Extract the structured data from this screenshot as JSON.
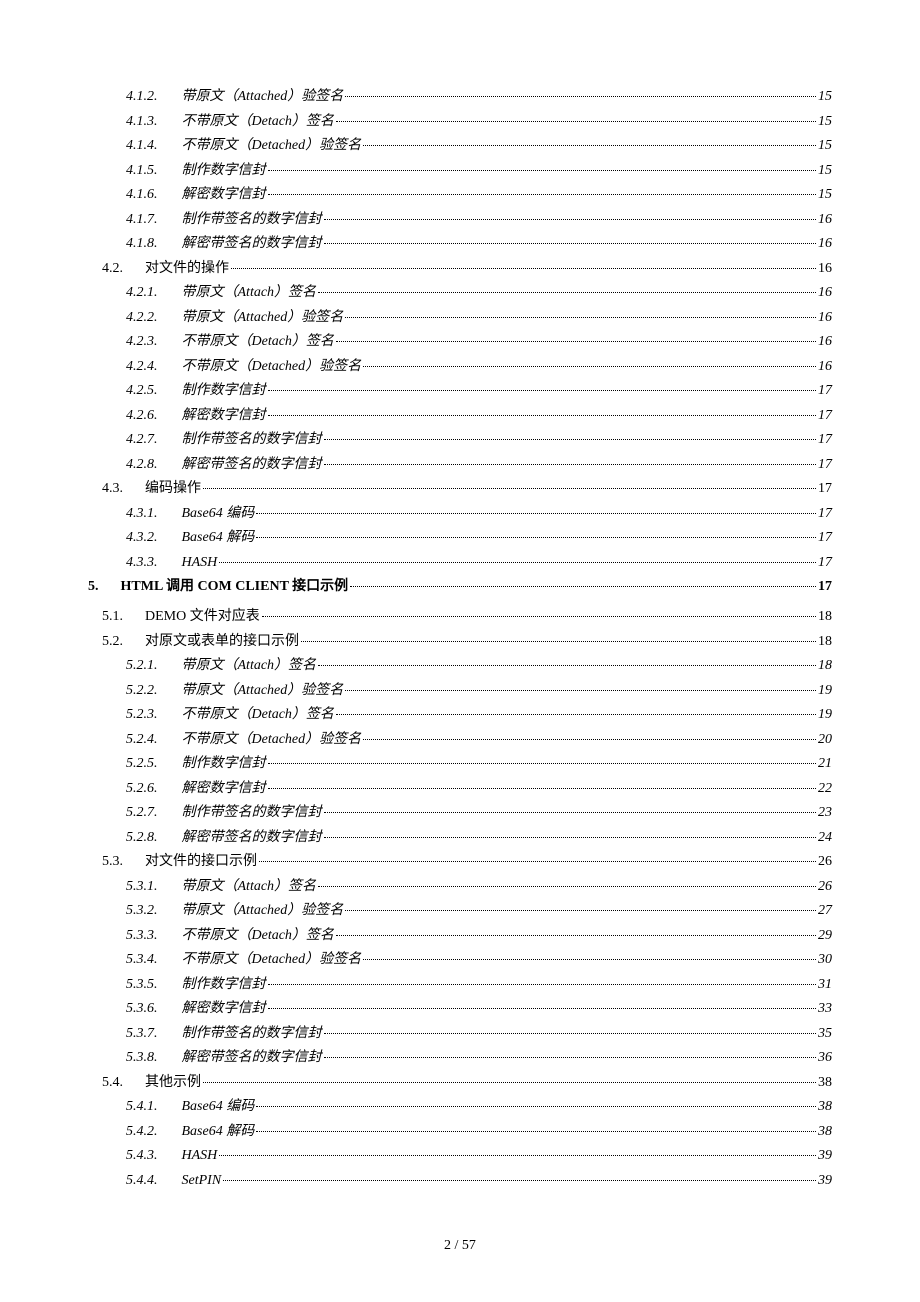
{
  "page_footer": "2 / 57",
  "toc": [
    {
      "level": 3,
      "num": "4.1.2.",
      "title": "带原文（Attached）验签名",
      "page": "15"
    },
    {
      "level": 3,
      "num": "4.1.3.",
      "title": "不带原文（Detach）签名",
      "page": "15"
    },
    {
      "level": 3,
      "num": "4.1.4.",
      "title": "不带原文（Detached）验签名",
      "page": "15"
    },
    {
      "level": 3,
      "num": "4.1.5.",
      "title": "制作数字信封",
      "page": "15"
    },
    {
      "level": 3,
      "num": "4.1.6.",
      "title": "解密数字信封",
      "page": "15"
    },
    {
      "level": 3,
      "num": "4.1.7.",
      "title": "制作带签名的数字信封",
      "page": "16"
    },
    {
      "level": 3,
      "num": "4.1.8.",
      "title": "解密带签名的数字信封",
      "page": "16"
    },
    {
      "level": 2,
      "num": "4.2.",
      "title": "对文件的操作",
      "page": "16"
    },
    {
      "level": 3,
      "num": "4.2.1.",
      "title": "带原文（Attach）签名",
      "page": "16"
    },
    {
      "level": 3,
      "num": "4.2.2.",
      "title": "带原文（Attached）验签名",
      "page": "16"
    },
    {
      "level": 3,
      "num": "4.2.3.",
      "title": "不带原文（Detach）签名",
      "page": "16"
    },
    {
      "level": 3,
      "num": "4.2.4.",
      "title": "不带原文（Detached）验签名",
      "page": "16"
    },
    {
      "level": 3,
      "num": "4.2.5.",
      "title": "制作数字信封",
      "page": "17"
    },
    {
      "level": 3,
      "num": "4.2.6.",
      "title": "解密数字信封",
      "page": "17"
    },
    {
      "level": 3,
      "num": "4.2.7.",
      "title": "制作带签名的数字信封",
      "page": "17"
    },
    {
      "level": 3,
      "num": "4.2.8.",
      "title": "解密带签名的数字信封",
      "page": "17"
    },
    {
      "level": 2,
      "num": "4.3.",
      "title": "编码操作",
      "page": "17"
    },
    {
      "level": 3,
      "num": "4.3.1.",
      "title": "Base64 编码",
      "page": "17"
    },
    {
      "level": 3,
      "num": "4.3.2.",
      "title": "Base64 解码",
      "page": "17"
    },
    {
      "level": 3,
      "num": "4.3.3.",
      "title": "HASH",
      "page": "17"
    },
    {
      "level": 1,
      "num": "5.",
      "title": "HTML 调用 COM CLIENT 接口示例",
      "page": "17"
    },
    {
      "level": 2,
      "num": "5.1.",
      "title": "DEMO 文件对应表",
      "page": "18",
      "smallcaps": true
    },
    {
      "level": 2,
      "num": "5.2.",
      "title": "对原文或表单的接口示例",
      "page": "18"
    },
    {
      "level": 3,
      "num": "5.2.1.",
      "title": "带原文（Attach）签名",
      "page": "18"
    },
    {
      "level": 3,
      "num": "5.2.2.",
      "title": "带原文（Attached）验签名",
      "page": "19"
    },
    {
      "level": 3,
      "num": "5.2.3.",
      "title": "不带原文（Detach）签名",
      "page": "19"
    },
    {
      "level": 3,
      "num": "5.2.4.",
      "title": "不带原文（Detached）验签名",
      "page": "20"
    },
    {
      "level": 3,
      "num": "5.2.5.",
      "title": "制作数字信封",
      "page": "21"
    },
    {
      "level": 3,
      "num": "5.2.6.",
      "title": "解密数字信封",
      "page": "22"
    },
    {
      "level": 3,
      "num": "5.2.7.",
      "title": "制作带签名的数字信封",
      "page": "23"
    },
    {
      "level": 3,
      "num": "5.2.8.",
      "title": "解密带签名的数字信封",
      "page": "24"
    },
    {
      "level": 2,
      "num": "5.3.",
      "title": "对文件的接口示例",
      "page": "26"
    },
    {
      "level": 3,
      "num": "5.3.1.",
      "title": "带原文（Attach）签名",
      "page": "26"
    },
    {
      "level": 3,
      "num": "5.3.2.",
      "title": "带原文（Attached）验签名",
      "page": "27"
    },
    {
      "level": 3,
      "num": "5.3.3.",
      "title": "不带原文（Detach）签名",
      "page": "29"
    },
    {
      "level": 3,
      "num": "5.3.4.",
      "title": "不带原文（Detached）验签名",
      "page": "30"
    },
    {
      "level": 3,
      "num": "5.3.5.",
      "title": "制作数字信封",
      "page": "31"
    },
    {
      "level": 3,
      "num": "5.3.6.",
      "title": "解密数字信封",
      "page": "33"
    },
    {
      "level": 3,
      "num": "5.3.7.",
      "title": "制作带签名的数字信封",
      "page": "35"
    },
    {
      "level": 3,
      "num": "5.3.8.",
      "title": "解密带签名的数字信封",
      "page": "36"
    },
    {
      "level": 2,
      "num": "5.4.",
      "title": "其他示例",
      "page": "38"
    },
    {
      "level": 3,
      "num": "5.4.1.",
      "title": "Base64 编码",
      "page": "38"
    },
    {
      "level": 3,
      "num": "5.4.2.",
      "title": "Base64 解码",
      "page": "38"
    },
    {
      "level": 3,
      "num": "5.4.3.",
      "title": "HASH",
      "page": "39"
    },
    {
      "level": 3,
      "num": "5.4.4.",
      "title": "SetPIN",
      "page": "39"
    }
  ]
}
